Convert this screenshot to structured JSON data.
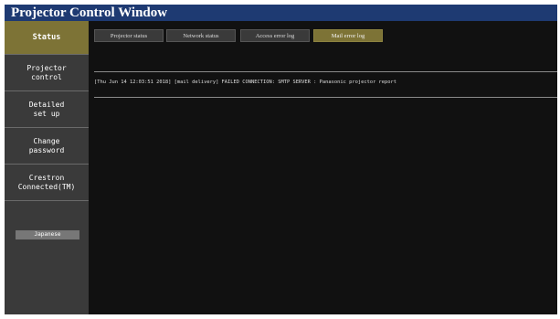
{
  "window": {
    "title": "Projector Control Window"
  },
  "sidebar": {
    "items": [
      {
        "label": "Status"
      },
      {
        "label": "Projector\ncontrol"
      },
      {
        "label": "Detailed\nset up"
      },
      {
        "label": "Change\npassword"
      },
      {
        "label": "Crestron\nConnected(TM)"
      }
    ],
    "language_button": "Japanese"
  },
  "tabs": [
    {
      "label": "Projector status"
    },
    {
      "label": "Network status"
    },
    {
      "label": "Access error log"
    },
    {
      "label": "Mail error log"
    }
  ],
  "log": {
    "entries": [
      "[Thu Jun 14 12:03:51 2018] [mail delivery] FAILED CONNECTION: SMTP SERVER : Panasonic projector report"
    ]
  },
  "colors": {
    "titlebar": "#1e3a72",
    "active": "#7d7336",
    "sidebar": "#3a3a3a",
    "content_bg": "#111111"
  }
}
